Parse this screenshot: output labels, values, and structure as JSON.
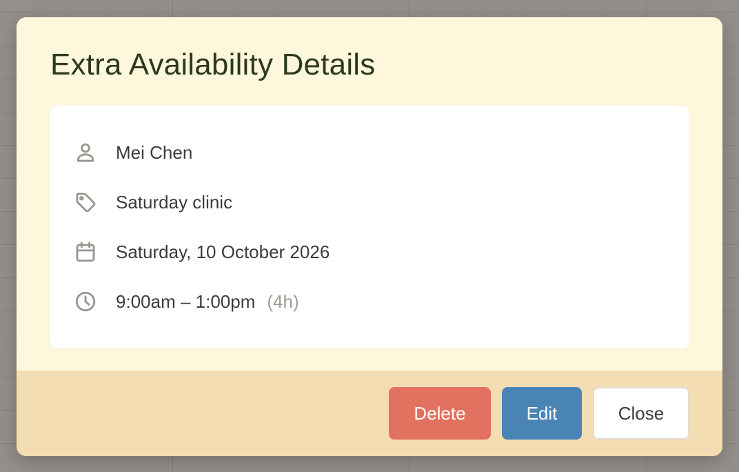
{
  "modal": {
    "title": "Extra Availability Details",
    "details": {
      "person": {
        "icon": "person-icon",
        "text": "Mei Chen"
      },
      "tag": {
        "icon": "tag-icon",
        "text": "Saturday clinic"
      },
      "date": {
        "icon": "calendar-icon",
        "text": "Saturday, 10 October 2026"
      },
      "time": {
        "icon": "clock-icon",
        "text": "9:00am – 1:00pm",
        "duration": "(4h)"
      }
    },
    "buttons": {
      "delete_label": "Delete",
      "edit_label": "Edit",
      "close_label": "Close"
    }
  },
  "colors": {
    "modal_background": "#fef7dc",
    "footer_background": "#f4ddb2",
    "title_color": "#2b3a1f",
    "delete_button": "#e2725f",
    "edit_button": "#4a84b5",
    "close_button": "#ffffff",
    "icon_color": "#9a948f",
    "backdrop": "#958f8b"
  }
}
